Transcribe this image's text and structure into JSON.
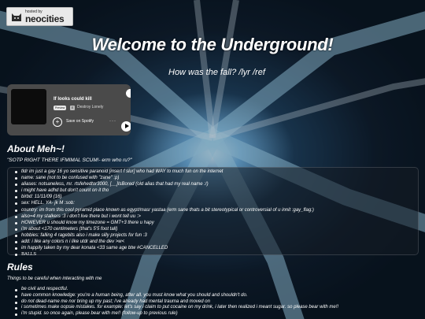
{
  "badge": {
    "line1": "hosted by",
    "line2": "neocities"
  },
  "header": {
    "title": "Welcome to the Underground!",
    "subtitle": "How was the fall? /lyr /ref"
  },
  "embed": {
    "song": "If looks could kill",
    "preview_label": "Preview",
    "explicit_label": "E",
    "artist": "Destroy Lonely",
    "save_label": "Save on Spotify",
    "dots": "···"
  },
  "about": {
    "heading": "About Meh~!",
    "quote": "\"SOTP RIGHT THERE IFMIMAL SCUM!- erm who ru?\"",
    "items": [
      "tldr im just a gay 16 yo sensitive paranoid [insert f slur] who had WAY to much fun on the internet",
      "name: sane (not to be confused with \"zane\" :p)",
      "aliases: notsaneless, mr. rtsfehedtor3000, [__]IsBored (old alias that had my real name :/)",
      "i might have adhd but don't count on it tho",
      "birbd: 11/11/09 (16)",
      "sex: HELL. YA- jk M :sob:",
      "country: im from this cool pyramid place known as egypt/masr yastaa (erm sane thats a bit stereotypical or controversial of u innit :gay_flag:)",
      "also=4 my stalkers :3 i don't live there but i wont tell uu :>",
      "HOWEVER u should know my timezone = GMT+3 there u hapy",
      "i'm about <170 centimeters (that's 5'5 foot tall)",
      "hobbies: falling 4 ragebits also i make silly projects for fun :3",
      "add: i like any colors n i like utdr and the dev >w<",
      "im happily taken by my dear konata <33 same age btw #CANCELLED"
    ],
    "last_item": "BALLS"
  },
  "rules": {
    "heading": "Rules",
    "intro": "Things to be careful when interacting with me",
    "items": [
      "be civil and respectful.",
      "have common knowledge: you're a human being, after all. you must know what you should and shouldn't do.",
      "do not dead-name me nor bring up my past; i've already had mental trauma and moved on",
      "i sometimes make oopsie mistakes. for example: let's say i claim to put cocaine on my drink, i later then realized i meant sugar. so please bear with me!!",
      "i'm stupid. so once again, please bear with me!! (follow-up to previous rule)"
    ]
  }
}
